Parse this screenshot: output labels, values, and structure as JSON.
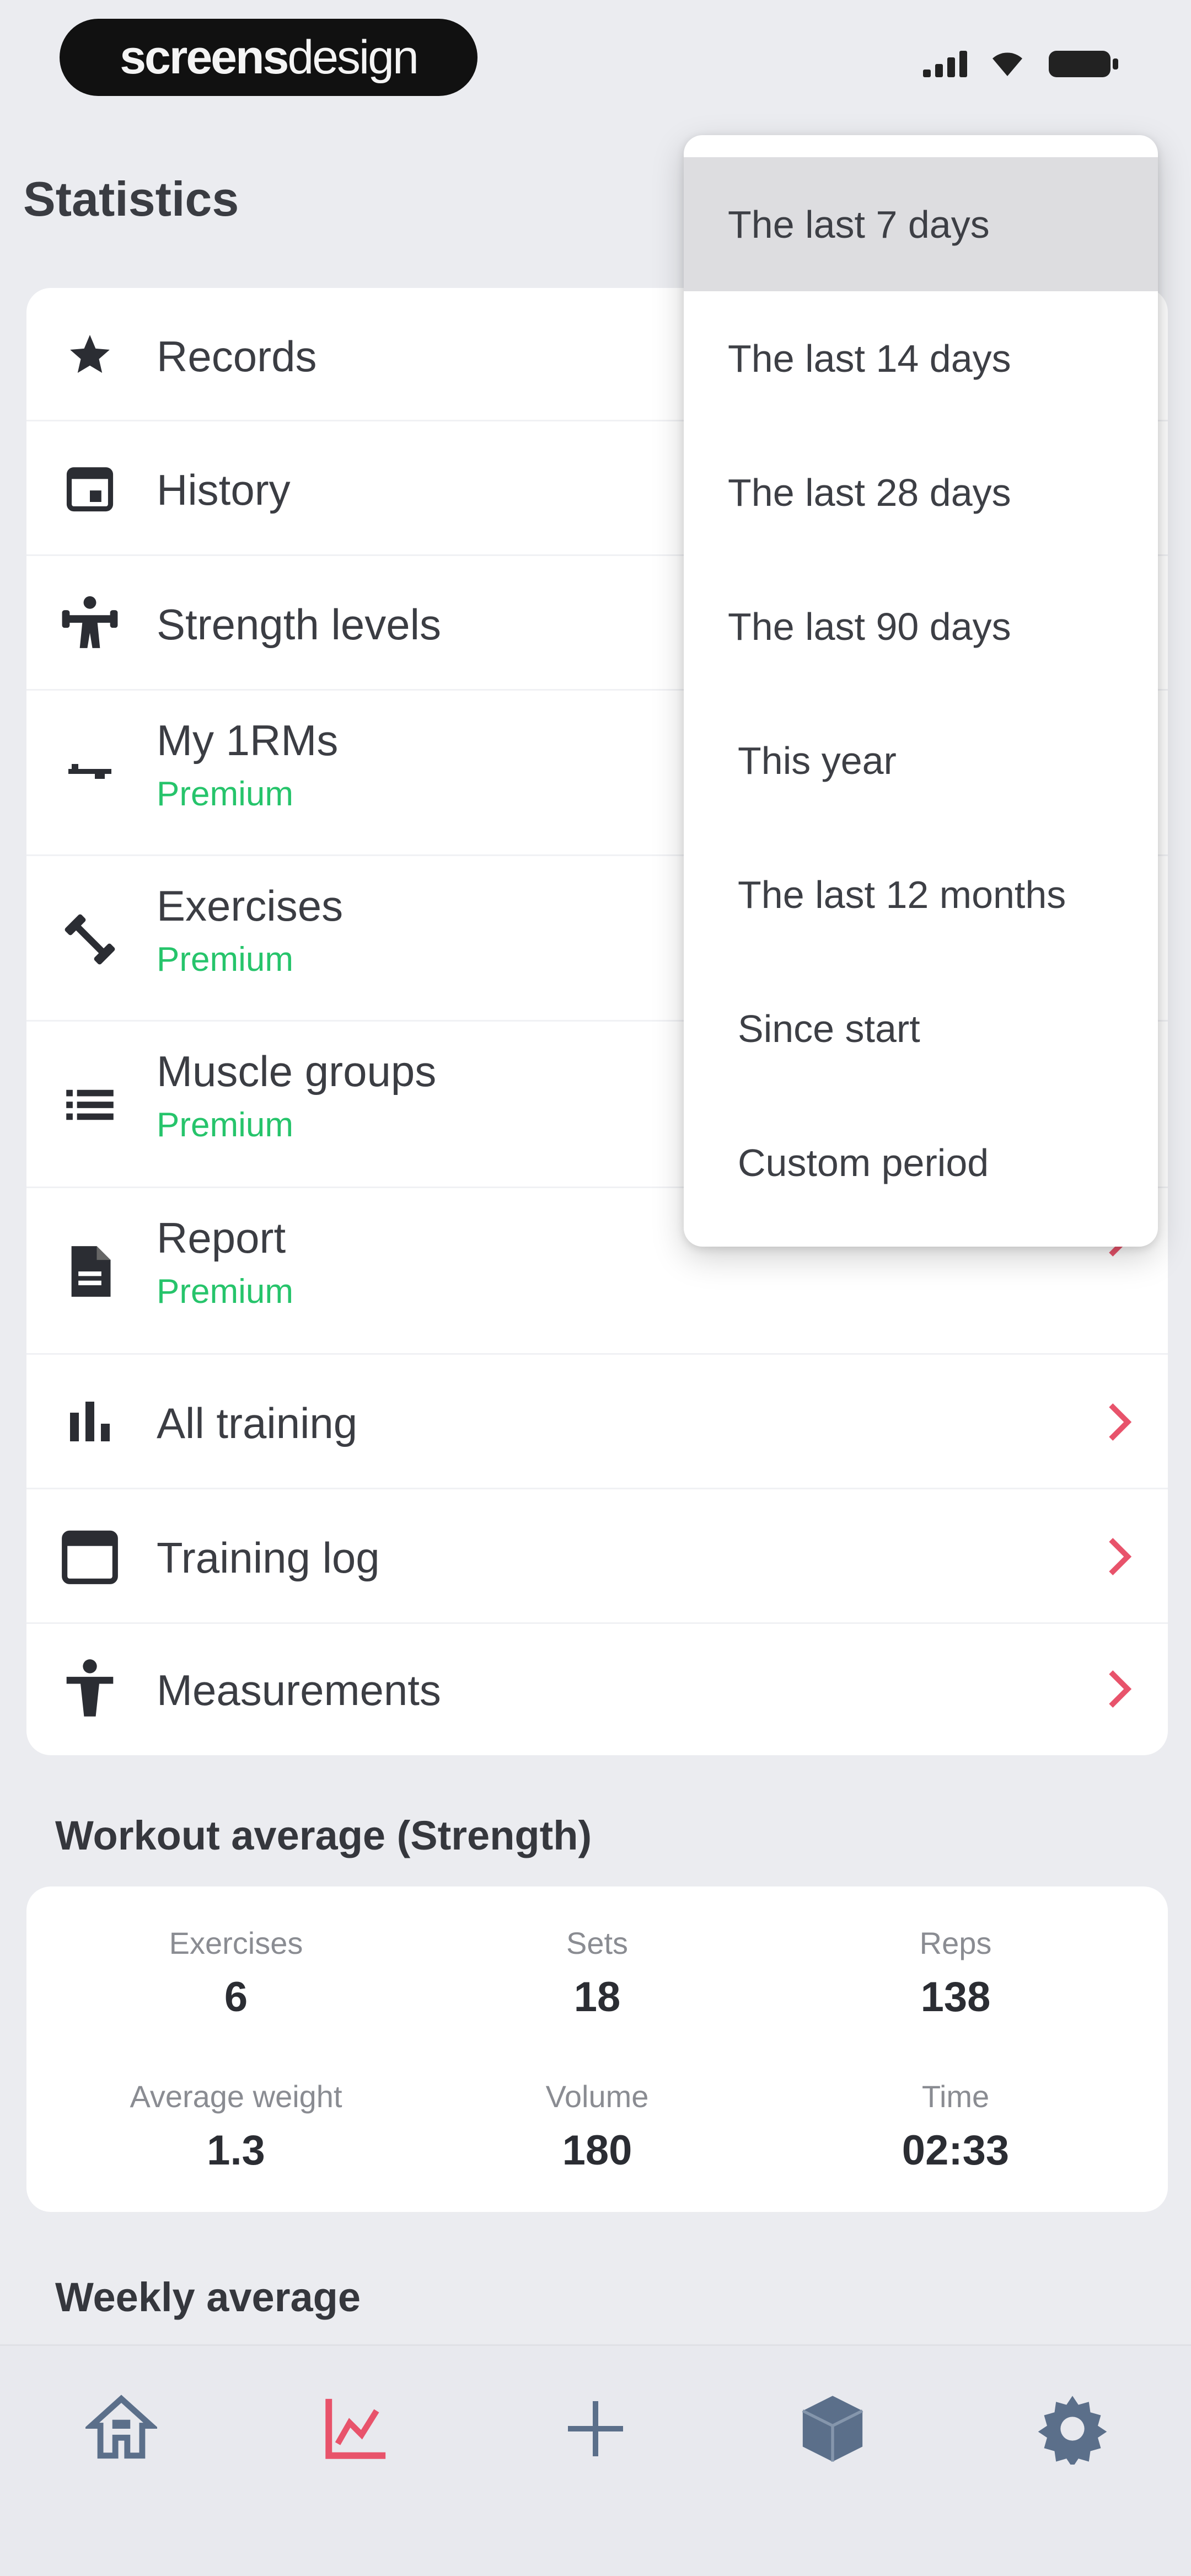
{
  "brand": {
    "bold": "screens",
    "light": "design"
  },
  "page_title": "Statistics",
  "menu": [
    {
      "label": "Records",
      "premium": ""
    },
    {
      "label": "History",
      "premium": ""
    },
    {
      "label": "Strength levels",
      "premium": ""
    },
    {
      "label": "My 1RMs",
      "premium": "Premium"
    },
    {
      "label": "Exercises",
      "premium": "Premium"
    },
    {
      "label": "Muscle groups",
      "premium": "Premium"
    },
    {
      "label": "Report",
      "premium": "Premium"
    },
    {
      "label": "All training",
      "premium": ""
    },
    {
      "label": "Training log",
      "premium": ""
    },
    {
      "label": "Measurements",
      "premium": ""
    }
  ],
  "workout_average": {
    "title": "Workout average (Strength)",
    "stats": [
      {
        "label": "Exercises",
        "value": "6"
      },
      {
        "label": "Sets",
        "value": "18"
      },
      {
        "label": "Reps",
        "value": "138"
      },
      {
        "label": "Average weight",
        "value": "1.3"
      },
      {
        "label": "Volume",
        "value": "180"
      },
      {
        "label": "Time",
        "value": "02:33"
      }
    ]
  },
  "weekly_average": {
    "title": "Weekly average"
  },
  "dropdown": {
    "options": [
      "The last 7 days",
      "The last 14 days",
      "The last 28 days",
      "The last 90 days",
      "This year",
      "The last 12 months",
      "Since start",
      "Custom period"
    ],
    "selected": "The last 7 days"
  },
  "colors": {
    "accent": "#e8536b",
    "premium": "#26c46b",
    "nav_inactive": "#5b6f8a",
    "background": "#ebecf0"
  },
  "nav_icons": [
    "home-icon",
    "chart-icon",
    "plus-icon",
    "cube-icon",
    "gear-icon"
  ]
}
